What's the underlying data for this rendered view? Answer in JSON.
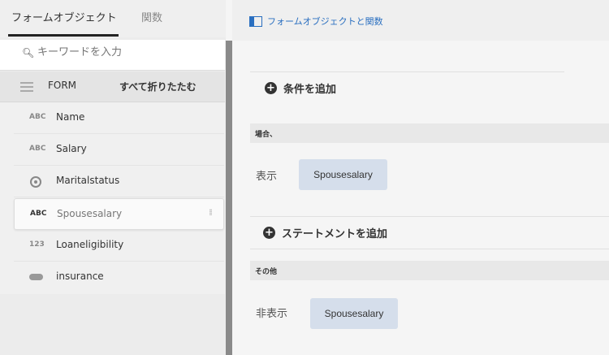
{
  "left_panel": {
    "tabs": [
      {
        "label": "フォームオブジェクト",
        "active": true
      },
      {
        "label": "関数",
        "active": false
      }
    ],
    "search": {
      "placeholder": "キーワードを入力"
    },
    "form_header": {
      "label": "FORM",
      "collapse_all": "すべて折りたたむ"
    },
    "items": [
      {
        "type_icon": "ABC",
        "label": "Name"
      },
      {
        "type_icon": "ABC",
        "label": "Salary"
      },
      {
        "type_icon": "radio",
        "label": "Maritalstatus"
      },
      {
        "type_icon": "ABC",
        "label": "Spousesalary",
        "selected": true
      },
      {
        "type_icon": "123",
        "label": "Loaneligibility"
      },
      {
        "type_icon": "toggle",
        "label": "insurance"
      }
    ]
  },
  "top_bar": {
    "link": "フォームオブジェクトと関数"
  },
  "rule": {
    "add_condition": "条件を追加",
    "when_label": "場合、",
    "then_action": "表示",
    "then_target": "Spousesalary",
    "add_statement": "ステートメントを追加",
    "else_label": "その他",
    "else_action": "非表示",
    "else_target": "Spousesalary"
  },
  "colors": {
    "accent": "#2a6fc0",
    "chip": "#d5deeb"
  }
}
